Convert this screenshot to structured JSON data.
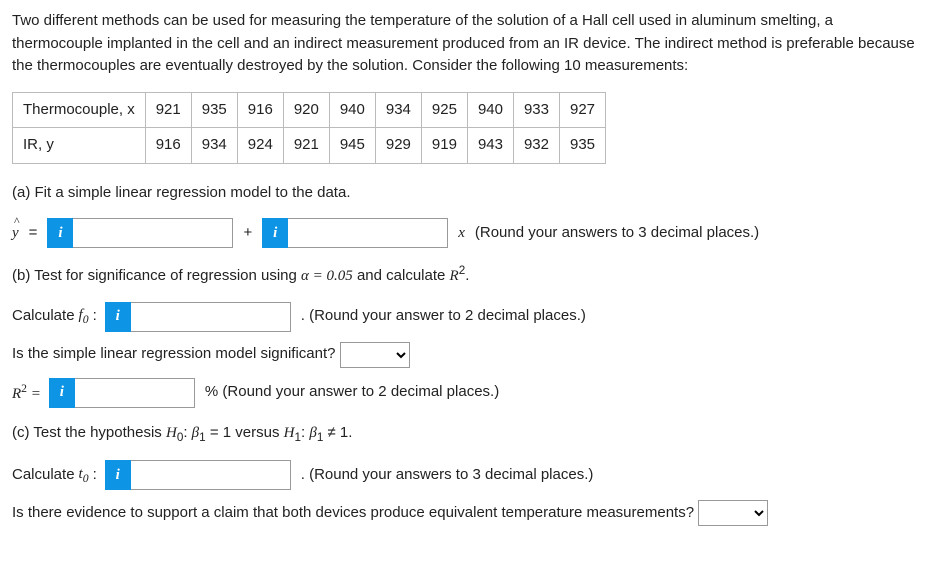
{
  "intro": "Two different methods can be used for measuring the temperature of the solution of a Hall cell used in aluminum smelting, a thermocouple implanted in the cell and an indirect measurement produced from an IR device. The indirect method is preferable because the thermocouples are eventually destroyed by the solution. Consider the following 10 measurements:",
  "table": {
    "h1": "Thermocouple, x",
    "h2": "IR, y",
    "r1": [
      "921",
      "935",
      "916",
      "920",
      "940",
      "934",
      "925",
      "940",
      "933",
      "927"
    ],
    "r2": [
      "916",
      "934",
      "924",
      "921",
      "945",
      "929",
      "919",
      "943",
      "932",
      "935"
    ]
  },
  "a": {
    "prompt": "(a) Fit a simple linear regression model to the data.",
    "yhat": "ŷ",
    "eq": "=",
    "plus": "+",
    "xlabel": "x",
    "hint": "(Round your answers to 3 decimal places.)",
    "icon": "i"
  },
  "b": {
    "prompt_pre": "(b) Test for significance of regression using ",
    "alpha": "α = 0.05",
    "prompt_post": " and calculate ",
    "r2_sym": "R²",
    "dot": ".",
    "calc_label": "Calculate ",
    "f0": "f₀",
    "colon": ":",
    "hint1": ". (Round your answer to 2 decimal places.)",
    "sig_q": "Is the simple linear regression model significant?",
    "r2_eq": "R² =",
    "r2_hint": "% (Round your answer to 2 decimal places.)",
    "icon": "i"
  },
  "c": {
    "prompt": "(c) Test the hypothesis H₀: β₁ = 1 versus H₁: β₁ ≠ 1.",
    "calc_label": "Calculate ",
    "t0": "t₀",
    "colon": ":",
    "hint": ". (Round your answers to 3 decimal places.)",
    "final_q": "Is there evidence to support a claim that both devices produce equivalent temperature measurements?",
    "icon": "i"
  }
}
